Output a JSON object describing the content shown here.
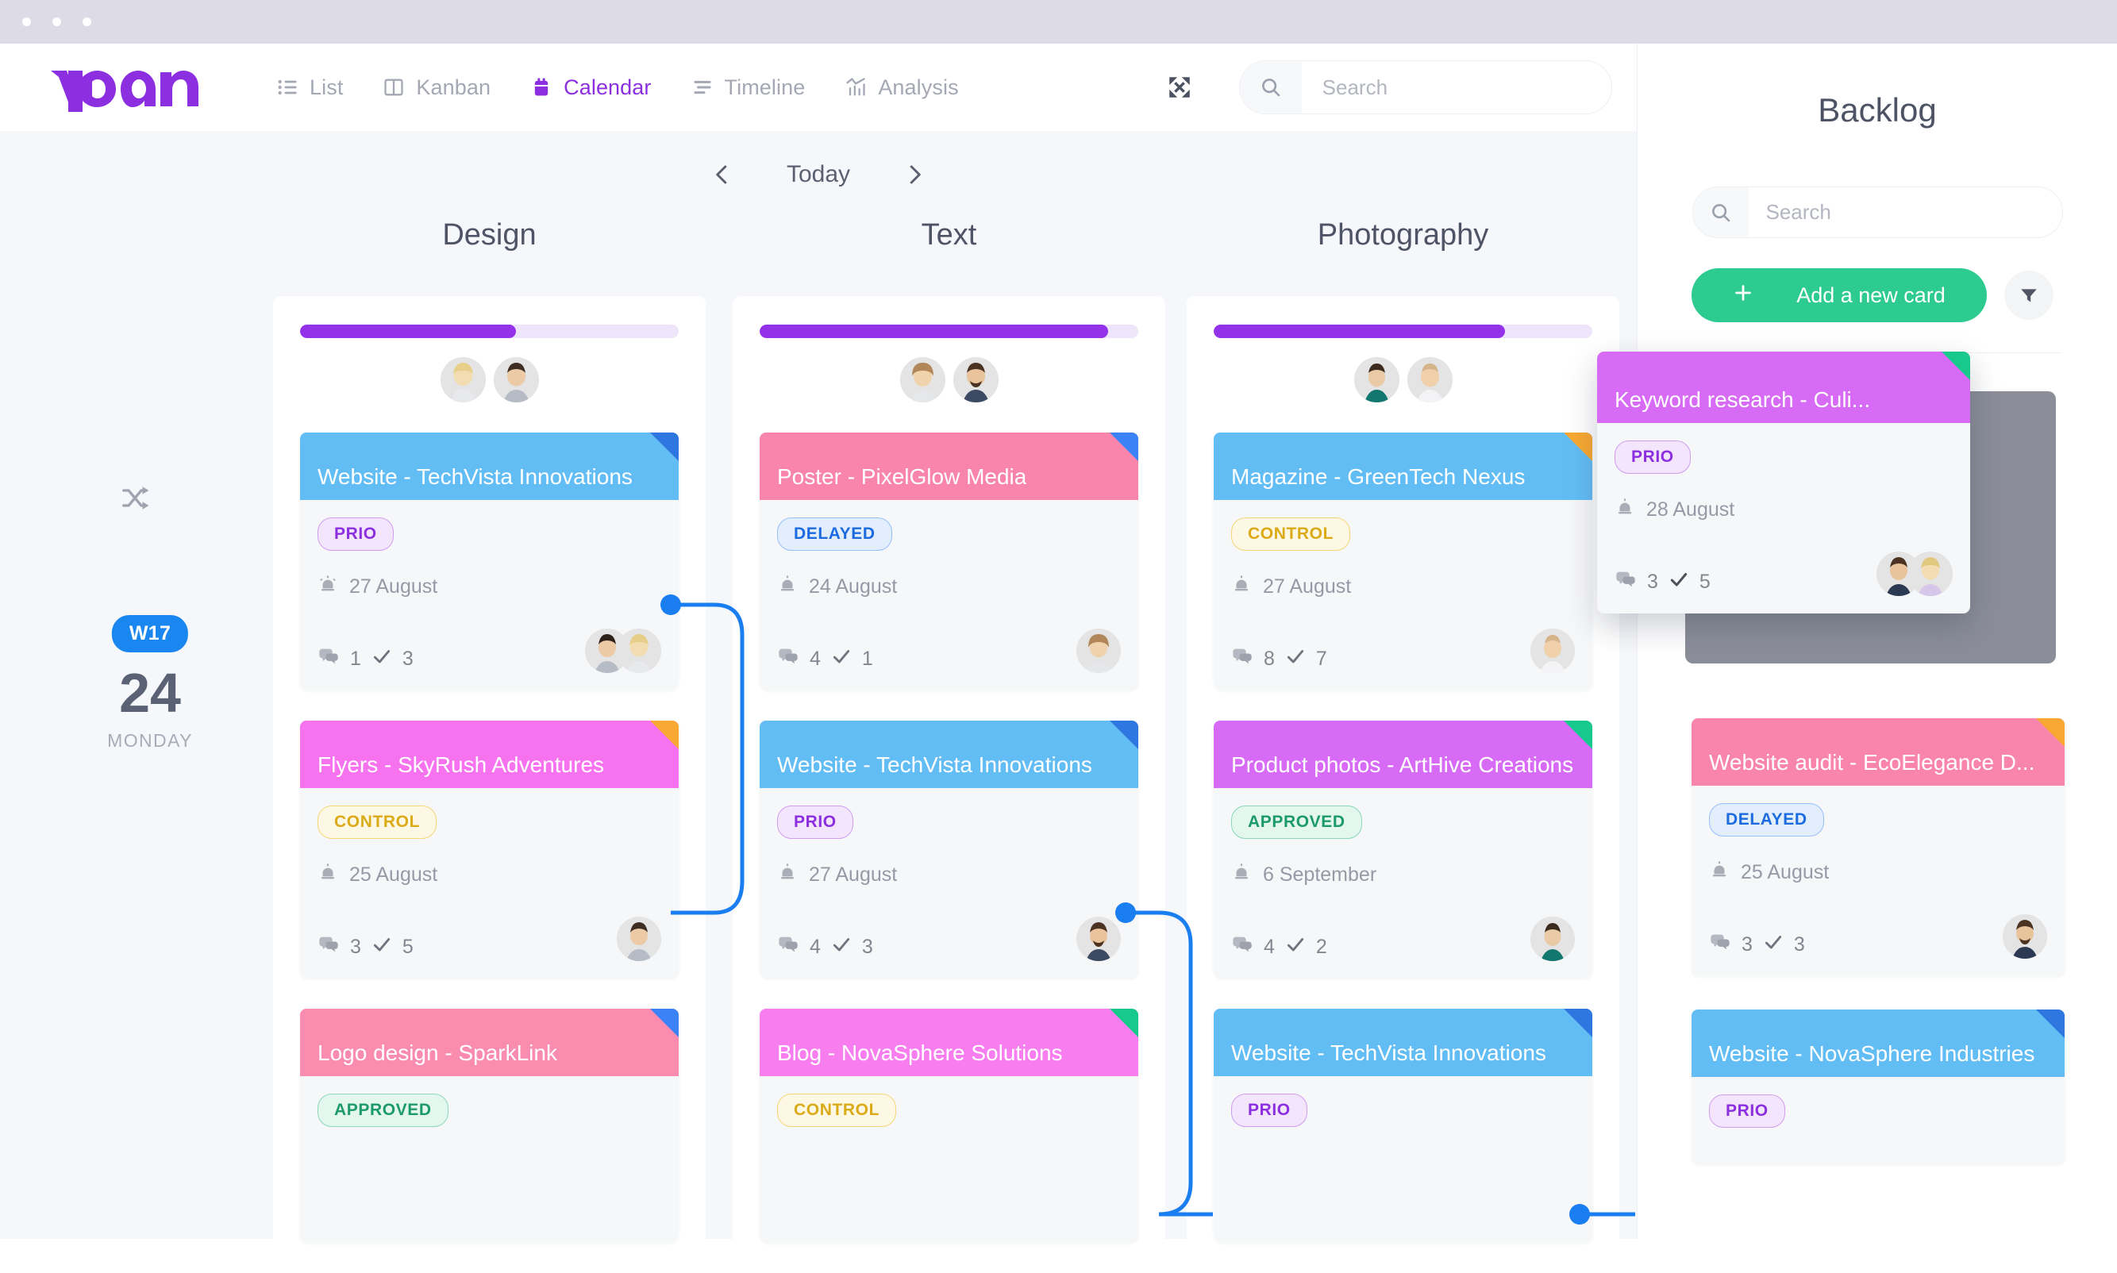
{
  "window": {
    "dots": 3
  },
  "header": {
    "logo_text": "vplan",
    "nav": [
      {
        "label": "List",
        "icon": "list-icon",
        "active": false
      },
      {
        "label": "Kanban",
        "icon": "kanban-icon",
        "active": false
      },
      {
        "label": "Calendar",
        "icon": "calendar-icon",
        "active": true
      },
      {
        "label": "Timeline",
        "icon": "timeline-icon",
        "active": false
      },
      {
        "label": "Analysis",
        "icon": "analysis-icon",
        "active": false
      }
    ],
    "expand_icon": "expand-icon",
    "search": {
      "placeholder": "Search",
      "value": "",
      "icon": "search-icon"
    }
  },
  "daynav": {
    "prev": "chevron-left-icon",
    "today_label": "Today",
    "next": "chevron-right-icon"
  },
  "rail": {
    "shuffle_icon": "shuffle-icon",
    "week_badge": "W17",
    "day_number": "24",
    "day_name": "MONDAY"
  },
  "columns": [
    {
      "title": "Design",
      "progress_percent": 57,
      "cards": [
        {
          "title": "Website - TechVista Innovations",
          "header_color": "#63bdf5",
          "corner_color": "#2f77e0",
          "tag": "PRIO",
          "tag_type": "prio",
          "due": "27 August",
          "comments": "1",
          "checks": "3",
          "avatars": 2
        },
        {
          "title": "Flyers - SkyRush Adventures",
          "header_color": "#f772ef",
          "corner_color": "#f9a933",
          "tag": "CONTROL",
          "tag_type": "control",
          "due": "25 August",
          "comments": "3",
          "checks": "5",
          "avatars": 1
        },
        {
          "title": "Logo design - SparkLink",
          "header_color": "#fa8cb0",
          "corner_color": "#3b82f6",
          "tag": "APPROVED",
          "tag_type": "approved",
          "due": "",
          "comments": "",
          "checks": "",
          "avatars": 0
        }
      ]
    },
    {
      "title": "Text",
      "progress_percent": 92,
      "cards": [
        {
          "title": "Poster - PixelGlow Media",
          "header_color": "#fa85ac",
          "corner_color": "#3b82f6",
          "tag": "DELAYED",
          "tag_type": "delayed",
          "due": "24 August",
          "comments": "4",
          "checks": "1",
          "avatars": 1
        },
        {
          "title": "Website - TechVista Innovations",
          "header_color": "#63bdf5",
          "corner_color": "#2f77e0",
          "tag": "PRIO",
          "tag_type": "prio",
          "due": "27 August",
          "comments": "4",
          "checks": "3",
          "avatars": 1
        },
        {
          "title": "Blog - NovaSphere Solutions",
          "header_color": "#f87ef0",
          "corner_color": "#17c98c",
          "tag": "CONTROL",
          "tag_type": "control",
          "due": "",
          "comments": "",
          "checks": "",
          "avatars": 0
        }
      ]
    },
    {
      "title": "Photography",
      "progress_percent": 77,
      "cards": [
        {
          "title": "Magazine - GreenTech Nexus",
          "header_color": "#63bdf5",
          "corner_color": "#f9a933",
          "tag": "CONTROL",
          "tag_type": "control",
          "due": "27 August",
          "comments": "8",
          "checks": "7",
          "avatars": 1
        },
        {
          "title": "Product photos - ArtHive Creations",
          "header_color": "#d76bf5",
          "corner_color": "#17c98c",
          "tag": "APPROVED",
          "tag_type": "approved",
          "due": "6 September",
          "comments": "4",
          "checks": "2",
          "avatars": 1
        },
        {
          "title": "Website - TechVista Innovations",
          "header_color": "#63bdf5",
          "corner_color": "#2f77e0",
          "tag": "PRIO",
          "tag_type": "prio",
          "due": "",
          "comments": "",
          "checks": "",
          "avatars": 0
        }
      ]
    }
  ],
  "backlog": {
    "title": "Backlog",
    "search": {
      "placeholder": "Search",
      "value": "",
      "icon": "search-icon"
    },
    "add_button": {
      "label": "Add a new card",
      "icon": "plus-icon",
      "color": "#2ecb91"
    },
    "filter_icon": "filter-icon",
    "dragging_card": {
      "title": "Keyword research - Culi...",
      "header_color": "#d76bf5",
      "corner_color": "#17c98c",
      "tag": "PRIO",
      "tag_type": "prio",
      "due": "28 August",
      "comments": "3",
      "checks": "5",
      "avatars": 2
    },
    "cards": [
      {
        "title": "Website audit -  EcoElegance D...",
        "header_color": "#fa85ac",
        "corner_color": "#f9a933",
        "tag": "DELAYED",
        "tag_type": "delayed",
        "due": "25 August",
        "comments": "3",
        "checks": "3",
        "avatars": 1
      },
      {
        "title": "Website - NovaSphere Industries",
        "header_color": "#63bdf5",
        "corner_color": "#2f77e0",
        "tag": "PRIO",
        "tag_type": "prio",
        "due": "",
        "comments": "",
        "checks": "",
        "avatars": 0
      }
    ]
  },
  "colors": {
    "accent_purple": "#8b2fe0",
    "accent_blue": "#1a87f0",
    "accent_green": "#2ecb91",
    "page_bg": "#f6f7fa",
    "chrome_bg": "#dddbe6"
  }
}
